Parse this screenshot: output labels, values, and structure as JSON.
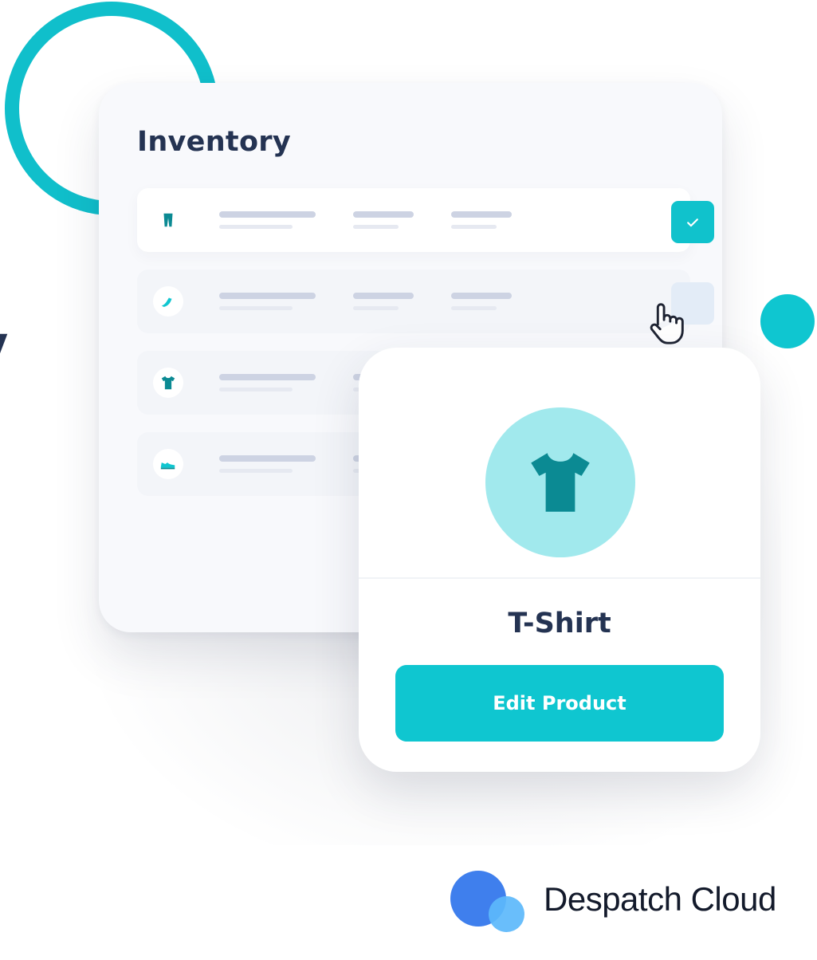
{
  "left_fragment_glyph": "y",
  "inventory": {
    "title": "Inventory",
    "rows": [
      {
        "icon": "trousers-icon",
        "checked": true
      },
      {
        "icon": "shoe-icon",
        "checked": false
      },
      {
        "icon": "tshirt-icon",
        "checked": false
      },
      {
        "icon": "sneaker-icon",
        "checked": false
      }
    ]
  },
  "product_card": {
    "icon": "tshirt-icon",
    "name": "T-Shirt",
    "button_label": "Edit Product"
  },
  "brand": {
    "name": "Despatch Cloud"
  },
  "colors": {
    "accent": "#0fc6d0",
    "heading": "#243352",
    "avatar_bg": "#a1e9ed",
    "icon_fill": "#0b8a93",
    "logo_blue": "#3f7fed",
    "logo_light_blue": "#5cb9fb"
  }
}
